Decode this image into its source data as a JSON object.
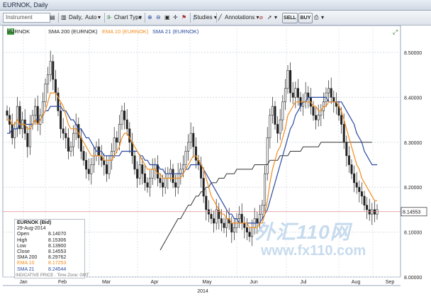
{
  "window": {
    "title": "EURNOK, Daily"
  },
  "toolbar": {
    "instrument_placeholder": "Instrument",
    "timeframe": "Daily,",
    "scale": "Auto",
    "chart_type": "Chart Type",
    "studies": "Studies",
    "annotations": "Annotations",
    "sell": "SELL",
    "buy": "BUY"
  },
  "legend": {
    "symbol": "EURNOK",
    "sma200": "SMA 200 (EURNOK)",
    "ema10": "EMA 10 (EURNOK)",
    "sma21": "SMA 21 (EURNOK)"
  },
  "info": {
    "title": "EURNOK (Bid)",
    "date": "29-Aug-2014",
    "rows": [
      {
        "label": "Open",
        "value": "8.14070"
      },
      {
        "label": "High",
        "value": "8.15306"
      },
      {
        "label": "Low",
        "value": "8.13900"
      },
      {
        "label": "Close",
        "value": "8.14553"
      },
      {
        "label": "SMA 200",
        "value": "8.29762"
      },
      {
        "label": "EMA 10",
        "value": "8.17253"
      },
      {
        "label": "SMA 21",
        "value": "8.24544"
      }
    ],
    "footnote": "INDICATIVE PRICE · Time Zone: GMT"
  },
  "price_tag": "8.14553",
  "watermark": {
    "cn": "外汇110网",
    "url": "www.fx110.com"
  },
  "colors": {
    "sma200": "#333333",
    "ema10": "#f08c1e",
    "sma21": "#2a4aa0",
    "candle": "#222222",
    "last": "#e38a8a"
  },
  "chart_data": {
    "type": "candlestick",
    "y_ticks": [
      "8.50000",
      "8.40000",
      "8.30000",
      "8.20000",
      "8.10000",
      "8.00000"
    ],
    "ylim": [
      8.0,
      8.56
    ],
    "x_labels": [
      "Jan",
      "Feb",
      "Mar",
      "Apr",
      "May",
      "Jun",
      "Jul",
      "Aug",
      "Sep"
    ],
    "year_label": "2014",
    "grid": true,
    "last_close": 8.14553,
    "close": [
      8.36,
      8.34,
      8.31,
      8.33,
      8.38,
      8.33,
      8.35,
      8.32,
      8.29,
      8.34,
      8.36,
      8.38,
      8.34,
      8.36,
      8.39,
      8.43,
      8.45,
      8.48,
      8.44,
      8.41,
      8.37,
      8.33,
      8.32,
      8.31,
      8.28,
      8.29,
      8.32,
      8.34,
      8.31,
      8.28,
      8.26,
      8.24,
      8.23,
      8.25,
      8.27,
      8.29,
      8.27,
      8.26,
      8.25,
      8.23,
      8.26,
      8.28,
      8.31,
      8.3,
      8.34,
      8.37,
      8.35,
      8.33,
      8.3,
      8.27,
      8.24,
      8.22,
      8.25,
      8.23,
      8.21,
      8.2,
      8.22,
      8.24,
      8.25,
      8.22,
      8.21,
      8.2,
      8.22,
      8.23,
      8.24,
      8.21,
      8.2,
      8.23,
      8.24,
      8.25,
      8.28,
      8.3,
      8.32,
      8.29,
      8.26,
      8.25,
      8.22,
      8.18,
      8.15,
      8.14,
      8.13,
      8.12,
      8.15,
      8.13,
      8.12,
      8.11,
      8.13,
      8.12,
      8.1,
      8.11,
      8.13,
      8.14,
      8.12,
      8.11,
      8.1,
      8.09,
      8.11,
      8.13,
      8.12,
      8.14,
      8.16,
      8.23,
      8.31,
      8.36,
      8.38,
      8.34,
      8.32,
      8.35,
      8.39,
      8.42,
      8.46,
      8.41,
      8.4,
      8.42,
      8.4,
      8.38,
      8.39,
      8.41,
      8.4,
      8.38,
      8.36,
      8.35,
      8.36,
      8.37,
      8.39,
      8.41,
      8.42,
      8.4,
      8.39,
      8.38,
      8.36,
      8.34,
      8.3,
      8.27,
      8.25,
      8.23,
      8.21,
      8.2,
      8.19,
      8.18,
      8.16,
      8.15,
      8.14,
      8.15,
      8.14,
      8.15
    ],
    "ema10": [
      8.35,
      8.35,
      8.34,
      8.34,
      8.35,
      8.34,
      8.34,
      8.34,
      8.33,
      8.33,
      8.34,
      8.35,
      8.34,
      8.35,
      8.36,
      8.37,
      8.39,
      8.41,
      8.41,
      8.41,
      8.4,
      8.39,
      8.38,
      8.36,
      8.34,
      8.33,
      8.33,
      8.33,
      8.32,
      8.31,
      8.3,
      8.29,
      8.28,
      8.27,
      8.27,
      8.27,
      8.27,
      8.27,
      8.26,
      8.26,
      8.26,
      8.26,
      8.27,
      8.28,
      8.29,
      8.31,
      8.32,
      8.32,
      8.31,
      8.3,
      8.29,
      8.28,
      8.27,
      8.26,
      8.25,
      8.24,
      8.24,
      8.24,
      8.24,
      8.23,
      8.23,
      8.22,
      8.22,
      8.22,
      8.22,
      8.22,
      8.22,
      8.22,
      8.22,
      8.23,
      8.24,
      8.25,
      8.26,
      8.27,
      8.27,
      8.26,
      8.25,
      8.24,
      8.22,
      8.2,
      8.18,
      8.17,
      8.16,
      8.15,
      8.14,
      8.14,
      8.13,
      8.13,
      8.12,
      8.12,
      8.12,
      8.12,
      8.12,
      8.12,
      8.12,
      8.11,
      8.11,
      8.11,
      8.11,
      8.12,
      8.12,
      8.14,
      8.17,
      8.21,
      8.24,
      8.26,
      8.28,
      8.29,
      8.31,
      8.33,
      8.36,
      8.37,
      8.38,
      8.39,
      8.39,
      8.39,
      8.39,
      8.39,
      8.39,
      8.39,
      8.38,
      8.38,
      8.37,
      8.37,
      8.38,
      8.38,
      8.39,
      8.39,
      8.39,
      8.39,
      8.38,
      8.37,
      8.35,
      8.33,
      8.31,
      8.29,
      8.27,
      8.25,
      8.24,
      8.22,
      8.21,
      8.2,
      8.19,
      8.18,
      8.17,
      8.17
    ],
    "sma21": [
      8.32,
      8.32,
      8.33,
      8.33,
      8.33,
      8.34,
      8.34,
      8.34,
      8.34,
      8.34,
      8.34,
      8.35,
      8.35,
      8.35,
      8.36,
      8.37,
      8.37,
      8.38,
      8.38,
      8.38,
      8.38,
      8.38,
      8.37,
      8.37,
      8.36,
      8.35,
      8.35,
      8.34,
      8.33,
      8.33,
      8.32,
      8.31,
      8.31,
      8.3,
      8.29,
      8.28,
      8.28,
      8.28,
      8.27,
      8.27,
      8.27,
      8.27,
      8.27,
      8.27,
      8.27,
      8.28,
      8.28,
      8.28,
      8.28,
      8.28,
      8.28,
      8.28,
      8.27,
      8.27,
      8.26,
      8.26,
      8.25,
      8.25,
      8.25,
      8.25,
      8.24,
      8.24,
      8.23,
      8.23,
      8.23,
      8.23,
      8.23,
      8.23,
      8.23,
      8.23,
      8.24,
      8.24,
      8.25,
      8.25,
      8.25,
      8.25,
      8.25,
      8.24,
      8.23,
      8.22,
      8.21,
      8.2,
      8.19,
      8.18,
      8.17,
      8.16,
      8.15,
      8.14,
      8.14,
      8.13,
      8.13,
      8.12,
      8.12,
      8.12,
      8.12,
      8.12,
      8.12,
      8.12,
      8.12,
      8.12,
      8.13,
      8.14,
      8.15,
      8.17,
      8.19,
      8.21,
      8.23,
      8.25,
      8.27,
      8.29,
      8.31,
      8.33,
      8.34,
      8.36,
      8.37,
      8.38,
      8.39,
      8.39,
      8.4,
      8.4,
      8.4,
      8.4,
      8.4,
      8.4,
      8.4,
      8.4,
      8.39,
      8.39,
      8.39,
      8.39,
      8.39,
      8.39,
      8.38,
      8.37,
      8.36,
      8.35,
      8.34,
      8.32,
      8.31,
      8.3,
      8.28,
      8.27,
      8.26,
      8.25,
      8.25,
      8.25
    ],
    "sma200": [
      null,
      null,
      null,
      null,
      null,
      null,
      null,
      null,
      null,
      null,
      null,
      null,
      null,
      null,
      null,
      null,
      null,
      null,
      null,
      null,
      null,
      null,
      null,
      null,
      null,
      null,
      null,
      null,
      null,
      null,
      null,
      null,
      null,
      null,
      null,
      null,
      null,
      null,
      null,
      null,
      null,
      null,
      null,
      null,
      null,
      null,
      null,
      null,
      null,
      null,
      null,
      null,
      null,
      null,
      null,
      null,
      null,
      null,
      null,
      null,
      8.06,
      8.07,
      8.08,
      8.09,
      8.1,
      8.11,
      8.12,
      8.13,
      8.13,
      8.14,
      8.15,
      8.16,
      8.16,
      8.17,
      8.18,
      8.18,
      8.19,
      8.19,
      8.2,
      8.2,
      8.21,
      8.21,
      8.21,
      8.22,
      8.22,
      8.22,
      8.23,
      8.23,
      8.23,
      8.23,
      8.24,
      8.24,
      8.24,
      8.24,
      8.24,
      8.24,
      8.24,
      8.25,
      8.25,
      8.25,
      8.25,
      8.25,
      8.25,
      8.26,
      8.26,
      8.26,
      8.26,
      8.27,
      8.27,
      8.27,
      8.27,
      8.28,
      8.28,
      8.28,
      8.28,
      8.28,
      8.29,
      8.29,
      8.29,
      8.29,
      8.29,
      8.29,
      8.29,
      8.3,
      8.3,
      8.3,
      8.3,
      8.3,
      8.3,
      8.3,
      8.3,
      8.3,
      8.3,
      8.3,
      8.3,
      8.3,
      8.3,
      8.3,
      8.3,
      8.3,
      8.3,
      8.3,
      8.3,
      8.3
    ]
  }
}
